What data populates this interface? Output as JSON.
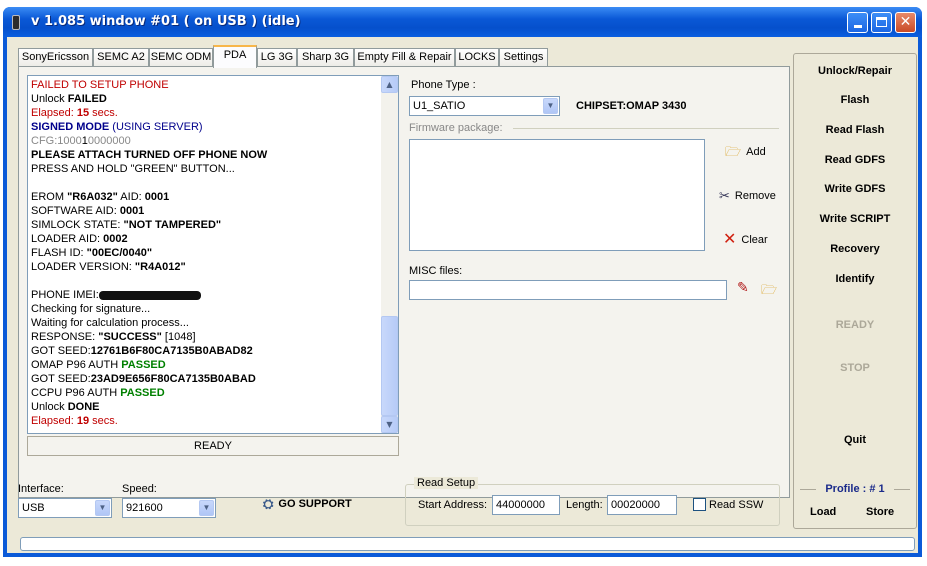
{
  "window": {
    "title": "v 1.085 window #01 ( on USB ) (idle)"
  },
  "tabs": [
    {
      "label": "SonyEricsson"
    },
    {
      "label": "SEMC A2"
    },
    {
      "label": "SEMC ODM"
    },
    {
      "label": "PDA",
      "active": true
    },
    {
      "label": "LG 3G"
    },
    {
      "label": "Sharp 3G"
    },
    {
      "label": "Empty Fill & Repair"
    },
    {
      "label": "LOCKS"
    },
    {
      "label": "Settings"
    }
  ],
  "log": {
    "l1": "FAILED TO SETUP PHONE",
    "l2a": "Unlock ",
    "l2b": "FAILED",
    "l3a": "Elapsed: ",
    "l3b": "15",
    "l3c": " secs.",
    "l4a": "SIGNED MODE",
    "l4b": " (USING SERVER)",
    "l5a": "CFG:",
    "l5b": "1000",
    "l5c": "1",
    "l5d": "0000000",
    "l6": "PLEASE ATTACH TURNED OFF PHONE NOW",
    "l7": "PRESS AND HOLD \"GREEN\" BUTTON...",
    "l8a": "EROM ",
    "l8b": "\"R6A032\"",
    "l8c": " AID: ",
    "l8d": "0001",
    "l9a": "SOFTWARE AID: ",
    "l9b": "0001",
    "l10a": "SIMLOCK STATE: ",
    "l10b": "\"NOT TAMPERED\"",
    "l11a": "LOADER AID: ",
    "l11b": "0002",
    "l12a": "FLASH ID: ",
    "l12b": "\"00EC/0040\"",
    "l13a": "LOADER VERSION: ",
    "l13b": "\"R4A012\"",
    "l14": "PHONE IMEI:",
    "l15": "Checking for signature...",
    "l16": "Waiting for calculation process...",
    "l17a": "RESPONSE: ",
    "l17b": "\"SUCCESS\"",
    "l17c": " [1048]",
    "l18a": "GOT SEED:",
    "l18b": "12761B6F80CA7135B0ABAD82",
    "l19a": "OMAP P96 AUTH ",
    "l19b": "PASSED",
    "l20a": "GOT SEED:",
    "l20b": "23AD9E656F80CA7135B0ABAD",
    "l21a": "CCPU P96 AUTH ",
    "l21b": "PASSED",
    "l22a": "Unlock ",
    "l22b": "DONE",
    "l23a": "Elapsed: ",
    "l23b": "19",
    "l23c": " secs."
  },
  "status": {
    "ready": "READY"
  },
  "pda": {
    "phone_type_label": "Phone Type :",
    "phone_type_value": "U1_SATIO",
    "chipset": "CHIPSET:OMAP 3430",
    "firmware_label": "Firmware package:",
    "add_label": "Add",
    "remove_label": "Remove",
    "clear_label": "Clear",
    "misc_label": "MISC files:"
  },
  "bottom": {
    "interface_label": "Interface:",
    "interface_value": "USB",
    "speed_label": "Speed:",
    "speed_value": "921600",
    "go_support_label": "GO SUPPORT",
    "read_setup_legend": "Read Setup",
    "start_address_label": "Start Address:",
    "start_address_value": "44000000",
    "length_label": "Length:",
    "length_value": "00020000",
    "read_ssw_label": "Read SSW"
  },
  "actions": {
    "unlock_repair": "Unlock/Repair",
    "flash": "Flash",
    "read_flash": "Read Flash",
    "read_gdfs": "Read GDFS",
    "write_gdfs": "Write GDFS",
    "write_script": "Write SCRIPT",
    "recovery": "Recovery",
    "identify": "Identify",
    "ready": "READY",
    "stop": "STOP",
    "quit": "Quit",
    "profile": "Profile : # 1",
    "load": "Load",
    "store": "Store"
  },
  "colors": {
    "title_bar": "#0a58d6",
    "panel_bg": "#ece9d8",
    "passed": "#008000",
    "error": "#c00000",
    "signed": "#00008b"
  }
}
